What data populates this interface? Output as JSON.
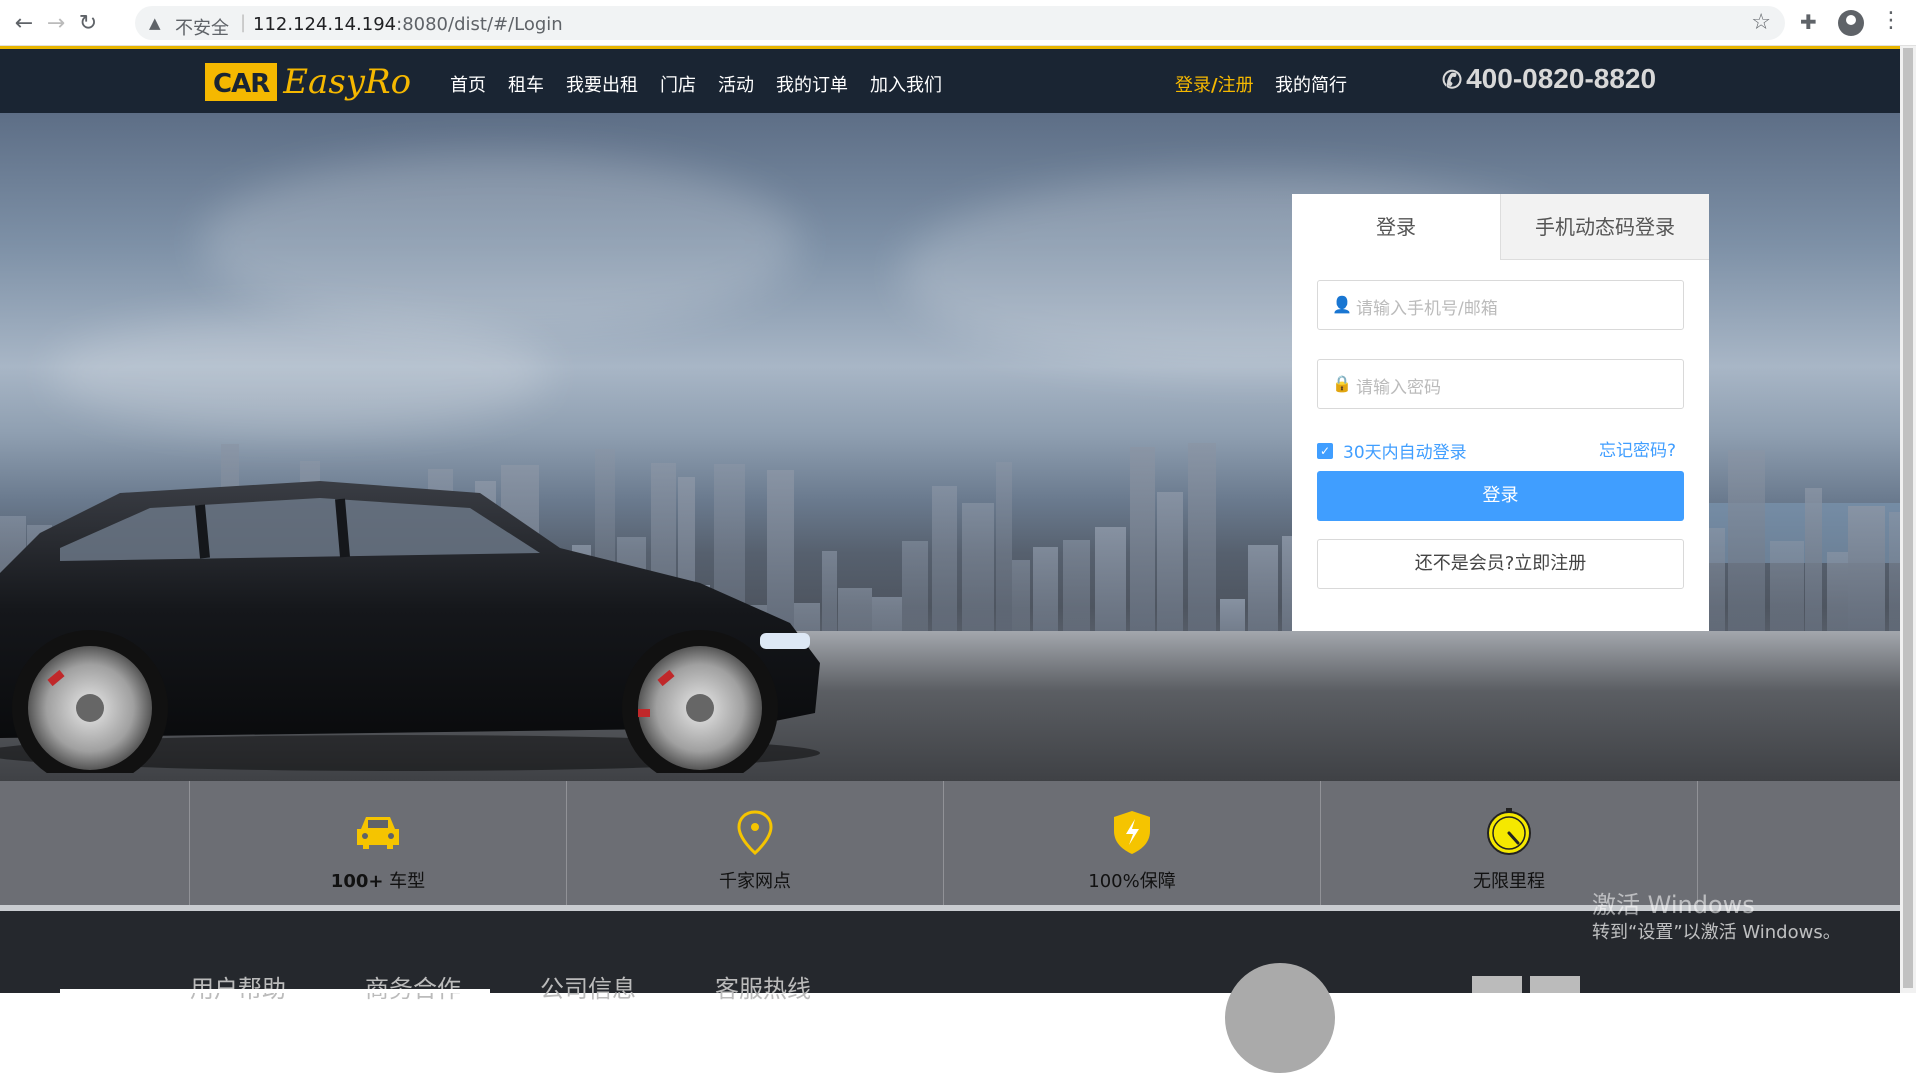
{
  "browser": {
    "insecure_label": "不安全",
    "url_host": "112.124.14.194",
    "url_rest": ":8080/dist/#/Login"
  },
  "header": {
    "logo_mark": "CAR",
    "logo_text": "EasyRo",
    "nav": [
      "首页",
      "租车",
      "我要出租",
      "门店",
      "活动",
      "我的订单",
      "加入我们"
    ],
    "login": "登录",
    "register": "注册",
    "resume": "我的简行",
    "phone": "400-0820-8820",
    "accent_color": "#f5b800"
  },
  "login_form": {
    "tab_password": "登录",
    "tab_sms": "手机动态码登录",
    "account_placeholder": "请输入手机号/邮箱",
    "password_placeholder": "请输入密码",
    "remember_label": "30天内自动登录",
    "remember_checked": true,
    "forgot": "忘记密码?",
    "submit": "登录",
    "register": "还不是会员?立即注册",
    "primary_color": "#409eff"
  },
  "features": [
    {
      "bold": "100+",
      "text": " 车型",
      "icon": "car-icon"
    },
    {
      "bold": "",
      "text": "千家网点",
      "icon": "location-pin-icon"
    },
    {
      "bold": "",
      "text": "100%保障",
      "icon": "shield-icon"
    },
    {
      "bold": "",
      "text": "无限里程",
      "icon": "speedometer-icon"
    }
  ],
  "footer": {
    "links": [
      "用户帮助",
      "商务合作",
      "公司信息",
      "客服热线"
    ]
  },
  "watermark": {
    "line1": "激活 Windows",
    "line2": "转到“设置”以激活 Windows。"
  }
}
